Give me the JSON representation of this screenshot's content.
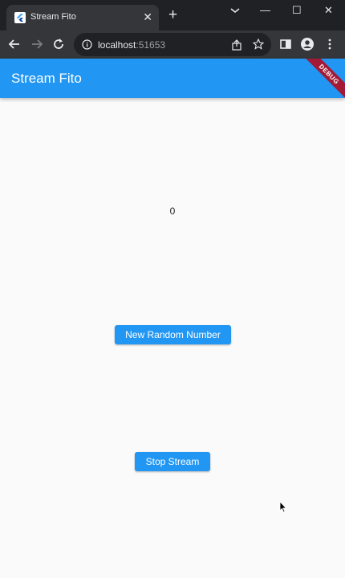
{
  "browser": {
    "tab_title": "Stream Fito",
    "tab_close": "✕",
    "new_tab": "+",
    "url_host": "localhost",
    "url_port": ":51653",
    "window_controls": {
      "minimize": "—",
      "maximize": "☐",
      "close": "✕"
    }
  },
  "app": {
    "title": "Stream Fito",
    "debug_banner": "DEBUG",
    "accent_color": "#2196f3",
    "counter_value": "0",
    "new_random_label": "New Random Number",
    "stop_stream_label": "Stop Stream"
  }
}
